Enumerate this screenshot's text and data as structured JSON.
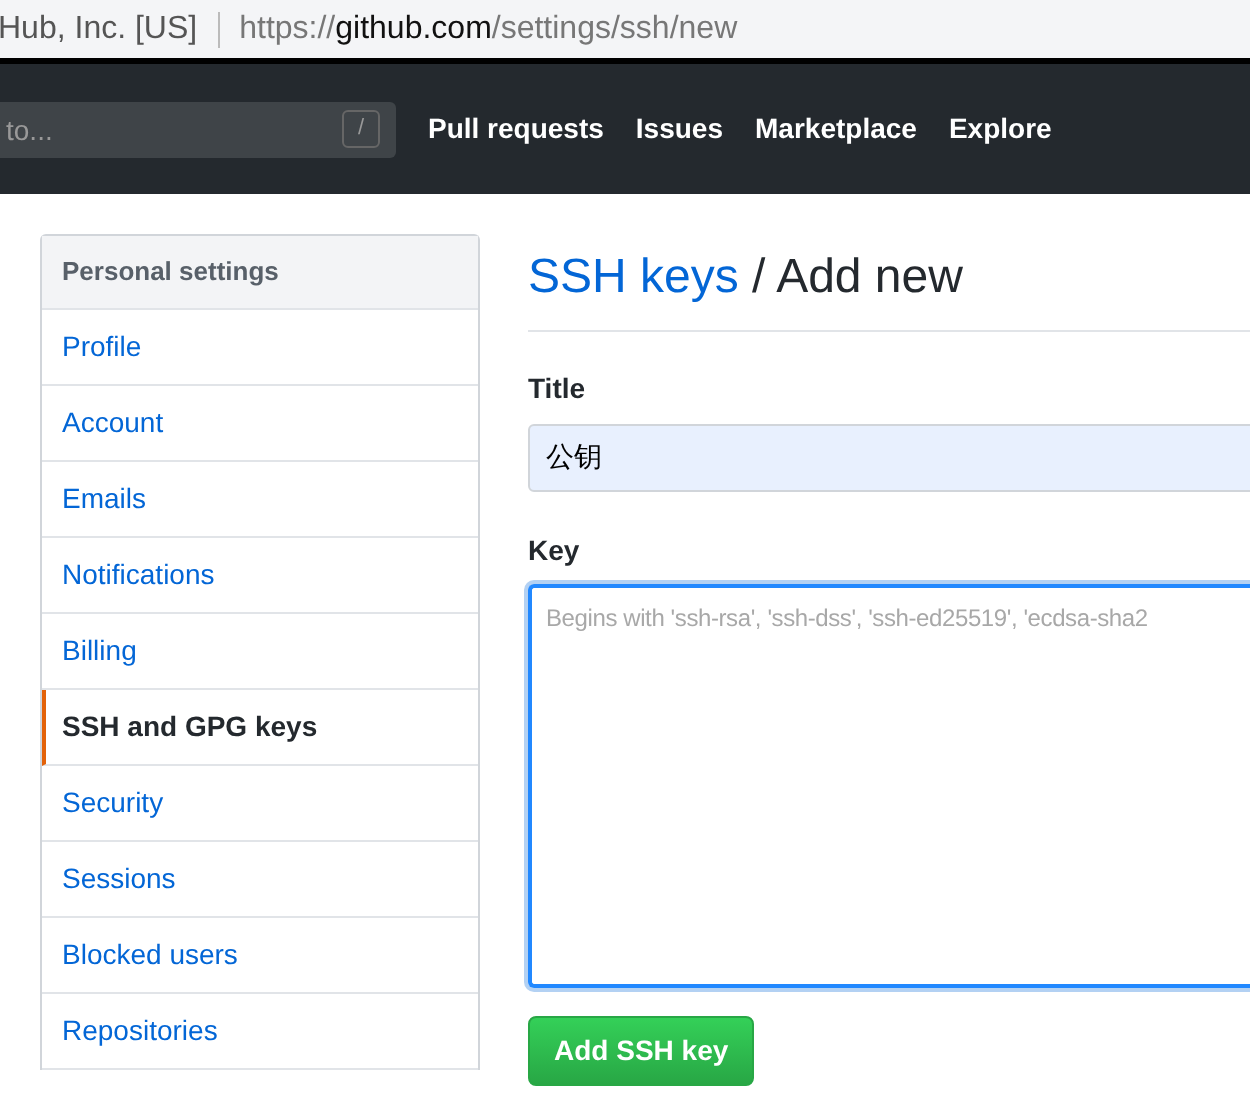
{
  "address_bar": {
    "site_identity": "Hub, Inc. [US]",
    "url_scheme": "https://",
    "url_host": "github.com",
    "url_path": "/settings/ssh/new"
  },
  "header": {
    "search": {
      "placeholder": "to...",
      "shortcut_key": "/"
    },
    "nav_links": [
      "Pull requests",
      "Issues",
      "Marketplace",
      "Explore"
    ]
  },
  "sidebar": {
    "heading": "Personal settings",
    "items": [
      {
        "label": "Profile",
        "selected": false
      },
      {
        "label": "Account",
        "selected": false
      },
      {
        "label": "Emails",
        "selected": false
      },
      {
        "label": "Notifications",
        "selected": false
      },
      {
        "label": "Billing",
        "selected": false
      },
      {
        "label": "SSH and GPG keys",
        "selected": true
      },
      {
        "label": "Security",
        "selected": false
      },
      {
        "label": "Sessions",
        "selected": false
      },
      {
        "label": "Blocked users",
        "selected": false
      },
      {
        "label": "Repositories",
        "selected": false
      }
    ]
  },
  "main": {
    "breadcrumb_link": "SSH keys",
    "separator": "/",
    "heading": "Add new",
    "title_label": "Title",
    "title_value": "公钥",
    "key_label": "Key",
    "key_placeholder": "Begins with 'ssh-rsa', 'ssh-dss', 'ssh-ed25519', 'ecdsa-sha2",
    "submit": "Add SSH key"
  }
}
